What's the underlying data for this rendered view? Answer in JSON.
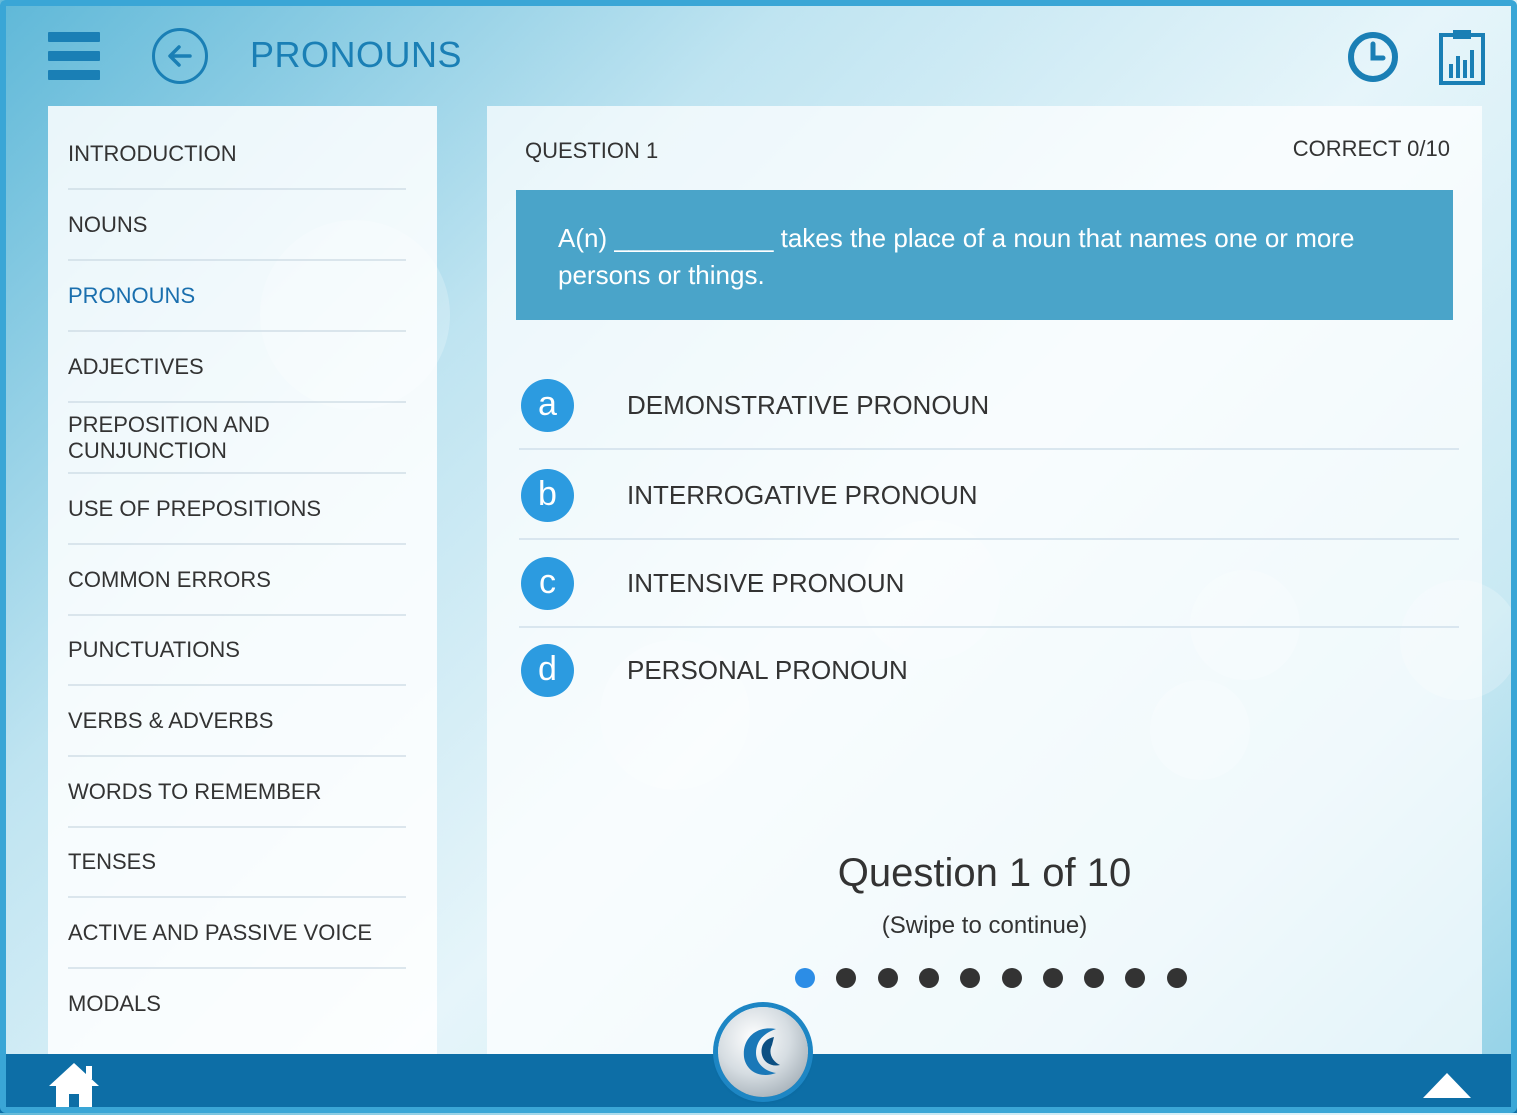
{
  "header": {
    "title": "PRONOUNS"
  },
  "sidebar": {
    "items": [
      {
        "label": "INTRODUCTION"
      },
      {
        "label": "NOUNS"
      },
      {
        "label": "PRONOUNS",
        "active": true
      },
      {
        "label": "ADJECTIVES"
      },
      {
        "label": "PREPOSITION AND CUNJUNCTION"
      },
      {
        "label": "USE OF PREPOSITIONS"
      },
      {
        "label": "COMMON ERRORS"
      },
      {
        "label": "PUNCTUATIONS"
      },
      {
        "label": "VERBS & ADVERBS"
      },
      {
        "label": "WORDS TO REMEMBER"
      },
      {
        "label": "TENSES"
      },
      {
        "label": "ACTIVE AND PASSIVE VOICE"
      },
      {
        "label": "MODALS"
      }
    ]
  },
  "quiz": {
    "question_label": "QUESTION 1",
    "score_label": "CORRECT 0/10",
    "question_text": "A(n) ___________ takes the place of a noun that names one or more persons or things.",
    "options": [
      {
        "letter": "a",
        "text": "DEMONSTRATIVE PRONOUN"
      },
      {
        "letter": "b",
        "text": "INTERROGATIVE PRONOUN"
      },
      {
        "letter": "c",
        "text": "INTENSIVE PRONOUN"
      },
      {
        "letter": "d",
        "text": "PERSONAL PRONOUN"
      }
    ],
    "progress_text": "Question 1 of 10",
    "swipe_hint": "(Swipe to continue)",
    "total_questions": 10,
    "current_question": 1
  },
  "icons": {
    "menu": "hamburger-icon",
    "back": "back-arrow-icon",
    "clock": "clock-icon",
    "report": "report-clipboard-icon",
    "home": "home-icon",
    "up": "up-triangle-icon",
    "logo": "app-logo"
  },
  "colors": {
    "accent": "#1a7fb5",
    "question_box": "#4aa4c9",
    "option_badge": "#2c9be0",
    "active_dot": "#2c8de6",
    "bottom_bar": "#0d6ea6"
  }
}
